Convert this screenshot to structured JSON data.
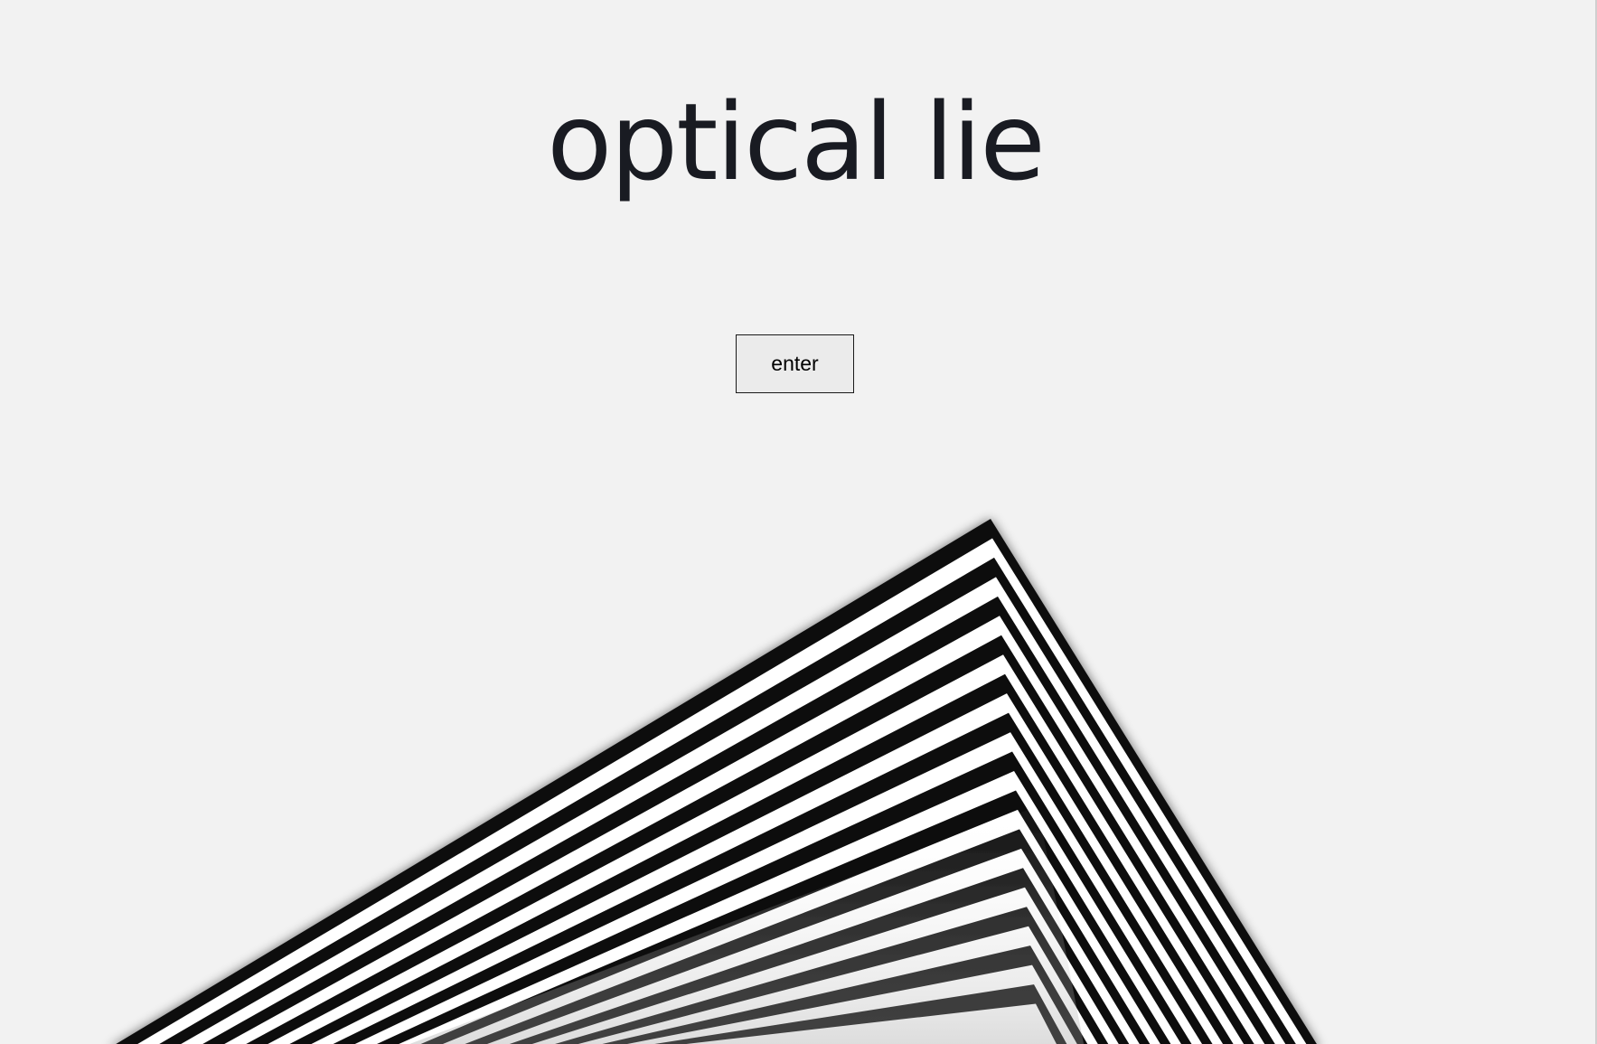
{
  "page": {
    "title": "optical lie",
    "enter_label": "enter"
  },
  "illusion": {
    "stripe_colors": [
      "#111111",
      "#ffffff"
    ],
    "background": "#f2f2f2"
  }
}
